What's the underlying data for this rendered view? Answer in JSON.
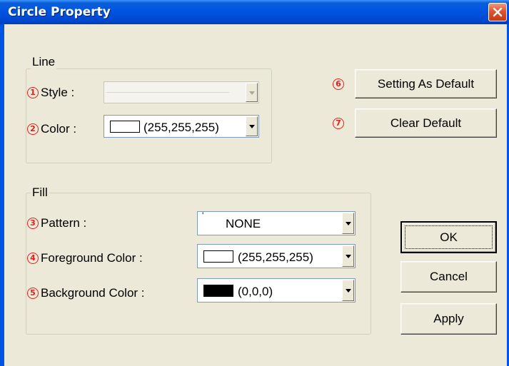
{
  "window": {
    "title": "Circle Property"
  },
  "line": {
    "group_label": "Line",
    "style_label": "Style :",
    "color_label": "Color :",
    "color_value": "(255,255,255)",
    "color_swatch": "#ffffff",
    "style_enabled": false
  },
  "fill": {
    "group_label": "Fill",
    "pattern_label": "Pattern :",
    "pattern_value": "NONE",
    "fg_label": "Foreground Color :",
    "fg_value": "(255,255,255)",
    "fg_swatch": "#ffffff",
    "bg_label": "Background Color :",
    "bg_value": "(0,0,0)",
    "bg_swatch": "#000000"
  },
  "markers": [
    "1",
    "2",
    "3",
    "4",
    "5",
    "6",
    "7"
  ],
  "buttons": {
    "set_default": "Setting As Default",
    "clear_default": "Clear Default",
    "ok": "OK",
    "cancel": "Cancel",
    "apply": "Apply"
  },
  "colors": {
    "titlebar": "#0054e3",
    "face": "#ece9d8",
    "marker": "#e0201c"
  },
  "icons": {
    "close": "close-x-icon",
    "dropdown": "chevron-down-icon"
  }
}
